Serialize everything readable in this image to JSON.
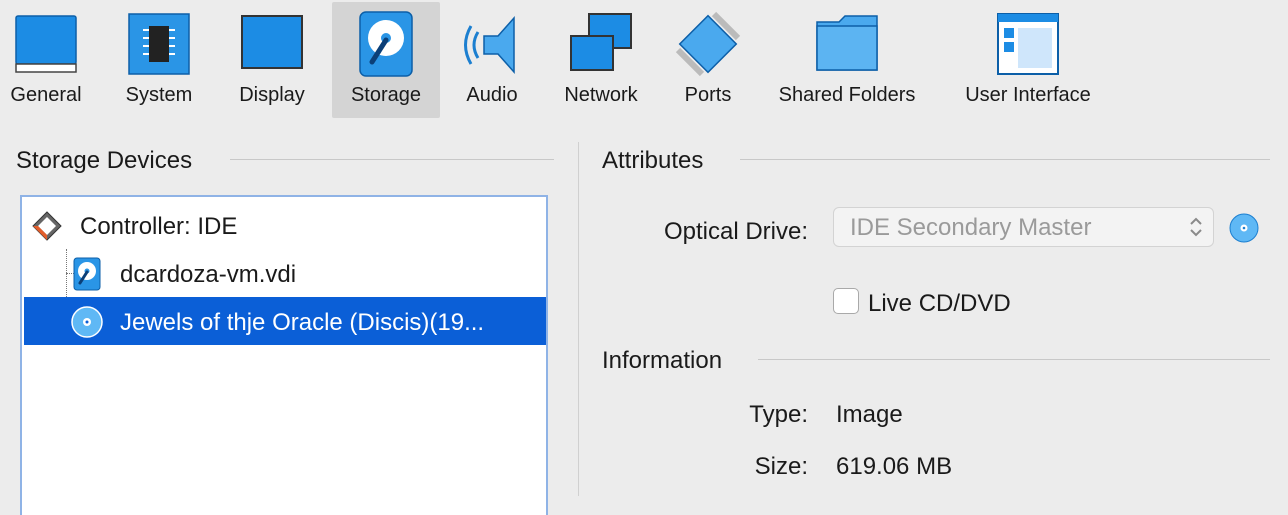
{
  "toolbar": {
    "items": [
      {
        "label": "General",
        "icon": "general-icon"
      },
      {
        "label": "System",
        "icon": "system-chip-icon"
      },
      {
        "label": "Display",
        "icon": "display-monitor-icon"
      },
      {
        "label": "Storage",
        "icon": "storage-disk-icon",
        "selected": true
      },
      {
        "label": "Audio",
        "icon": "audio-speaker-icon"
      },
      {
        "label": "Network",
        "icon": "network-icon"
      },
      {
        "label": "Ports",
        "icon": "ports-plug-icon"
      },
      {
        "label": "Shared Folders",
        "icon": "shared-folder-icon"
      },
      {
        "label": "User Interface",
        "icon": "user-interface-icon"
      }
    ]
  },
  "storage_devices": {
    "title": "Storage Devices",
    "controller": {
      "label": "Controller: IDE",
      "icon": "ide-controller-icon"
    },
    "items": [
      {
        "label": "dcardoza-vm.vdi",
        "icon": "hard-disk-icon"
      },
      {
        "label": "Jewels of thje Oracle (Discis)(19...",
        "icon": "optical-disc-icon",
        "selected": true
      }
    ]
  },
  "attributes": {
    "title": "Attributes",
    "optical_drive_label": "Optical Drive:",
    "optical_drive_value": "IDE Secondary Master",
    "live_cd_label": "Live CD/DVD",
    "live_cd_checked": false
  },
  "information": {
    "title": "Information",
    "type_label": "Type:",
    "type_value": "Image",
    "size_label": "Size:",
    "size_value": "619.06 MB"
  },
  "colors": {
    "accent": "#0b5fd7",
    "icon_blue": "#1f8ee6",
    "selected_tab_bg": "#d4d4d4"
  }
}
